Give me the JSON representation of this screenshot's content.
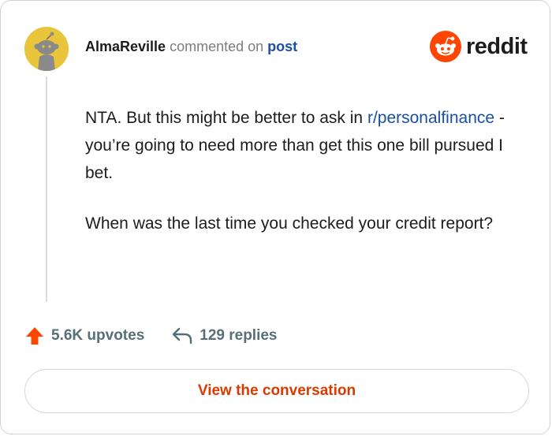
{
  "comment": {
    "author": "AlmaReville",
    "action_text": "commented on",
    "post_link_text": "post",
    "paragraph1_before": "NTA. But this might be better to ask in",
    "subreddit_link": "r/personalfinance",
    "paragraph1_after": "- you’re going to need more than get this one bill pursued I bet.",
    "paragraph2": "When was the last time you checked your credit report?"
  },
  "brand": {
    "name": "reddit",
    "icon": "reddit-logo-icon",
    "color": "#ff4500"
  },
  "stats": {
    "upvotes": "5.6K upvotes",
    "replies": "129 replies",
    "upvote_icon": "upvote-arrow-icon",
    "reply_icon": "reply-arrow-icon"
  },
  "cta": {
    "label": "View the conversation"
  },
  "colors": {
    "accent": "#d93a00",
    "link": "#1a4fa3",
    "avatar_bg": "#e8c53b",
    "upvote": "#ff4500"
  }
}
